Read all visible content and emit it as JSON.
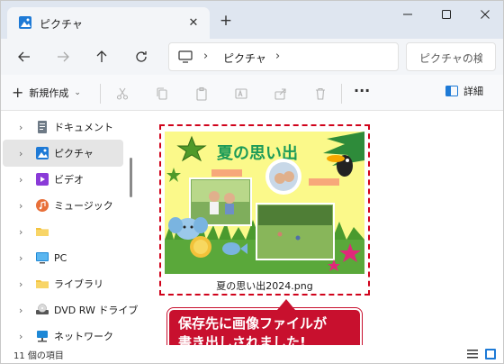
{
  "window": {
    "tab_title": "ピクチャ",
    "tab_close": "✕",
    "new_tab": "+"
  },
  "address": {
    "separator": "›",
    "crumb": "ピクチャ",
    "search_placeholder": "ピクチャの検索"
  },
  "commands": {
    "new_label": "新規作成",
    "new_plus": "+",
    "new_chevron": "⌄",
    "more_label": "···",
    "details_label": "詳細"
  },
  "sidebar": {
    "items": [
      {
        "label": "ドキュメント",
        "icon": "document-icon",
        "selected": false
      },
      {
        "label": "ピクチャ",
        "icon": "pictures-icon",
        "selected": true
      },
      {
        "label": "ビデオ",
        "icon": "videos-icon",
        "selected": false
      },
      {
        "label": "ミュージック",
        "icon": "music-icon",
        "selected": false
      },
      {
        "label": "",
        "icon": "folder-icon",
        "selected": false
      },
      {
        "label": "PC",
        "icon": "pc-icon",
        "selected": false
      },
      {
        "label": "ライブラリ",
        "icon": "folder-icon",
        "selected": false
      },
      {
        "label": "DVD RW ドライブ",
        "icon": "dvd-drive-icon",
        "selected": false
      },
      {
        "label": "ネットワーク",
        "icon": "network-icon",
        "selected": false
      }
    ],
    "chevron": "›"
  },
  "content": {
    "file_name": "夏の思い出2024.png",
    "thumbnail_title": "夏の思い出",
    "callout_line1": "保存先に画像ファイルが",
    "callout_line2": "書き出しされました!"
  },
  "status": {
    "item_count": "11 個の項目"
  },
  "colors": {
    "accent_red": "#c8102e",
    "titlebar": "#dfe6f0",
    "selection": "#e5e5e5"
  }
}
